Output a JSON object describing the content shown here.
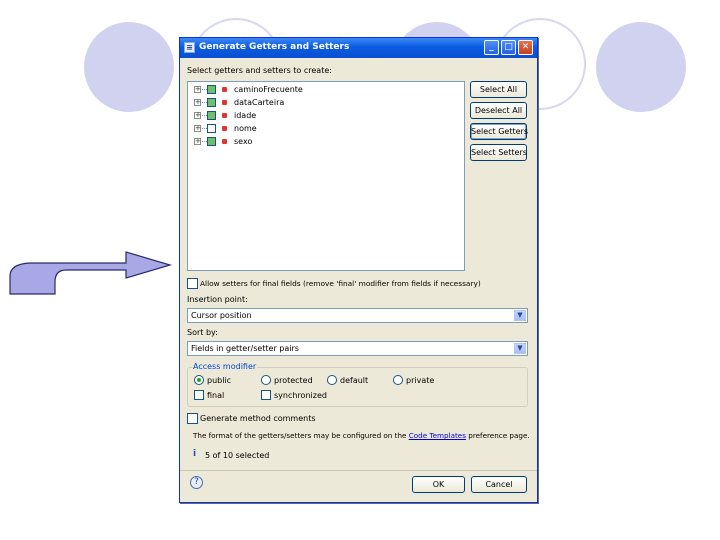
{
  "dialog": {
    "title": "Generate Getters and Setters",
    "select_label": "Select getters and setters to create:",
    "tree_items": [
      {
        "name": "caminoFrecuente",
        "checked": true
      },
      {
        "name": "dataCarteira",
        "checked": true
      },
      {
        "name": "idade",
        "checked": true
      },
      {
        "name": "nome",
        "checked": false
      },
      {
        "name": "sexo",
        "checked": true
      }
    ],
    "buttons": {
      "select_all": "Select All",
      "deselect_all": "Deselect All",
      "select_getters": "Select Getters",
      "select_setters": "Select Setters",
      "ok": "OK",
      "cancel": "Cancel"
    },
    "allow_setters_label": "Allow setters for final fields (remove 'final' modifier from fields if necessary)",
    "insertion_point_label": "Insertion point:",
    "insertion_point_value": "Cursor position",
    "sort_by_label": "Sort by:",
    "sort_by_value": "Fields in getter/setter pairs",
    "access_modifier": {
      "label": "Access modifier",
      "options": [
        "public",
        "protected",
        "default",
        "private"
      ],
      "selected": "public",
      "final_label": "final",
      "synchronized_label": "synchronized"
    },
    "generate_comments_label": "Generate method comments",
    "template_note_prefix": "The format of the getters/setters may be configured on the ",
    "template_link": "Code Templates",
    "template_note_suffix": " preference page.",
    "status": "5 of 10 selected"
  },
  "colors": {
    "circle_fill": "#d1d2f0",
    "titlebar": "#0b5ce2",
    "dialog_bg": "#ece9d8",
    "arrow_fill": "#a8a8e6"
  },
  "icons": {
    "app": "window-icon",
    "minimize": "minimize-icon",
    "maximize": "maximize-icon",
    "close": "close-icon",
    "info": "info-icon",
    "help": "help-icon",
    "arrow": "curved-arrow"
  }
}
